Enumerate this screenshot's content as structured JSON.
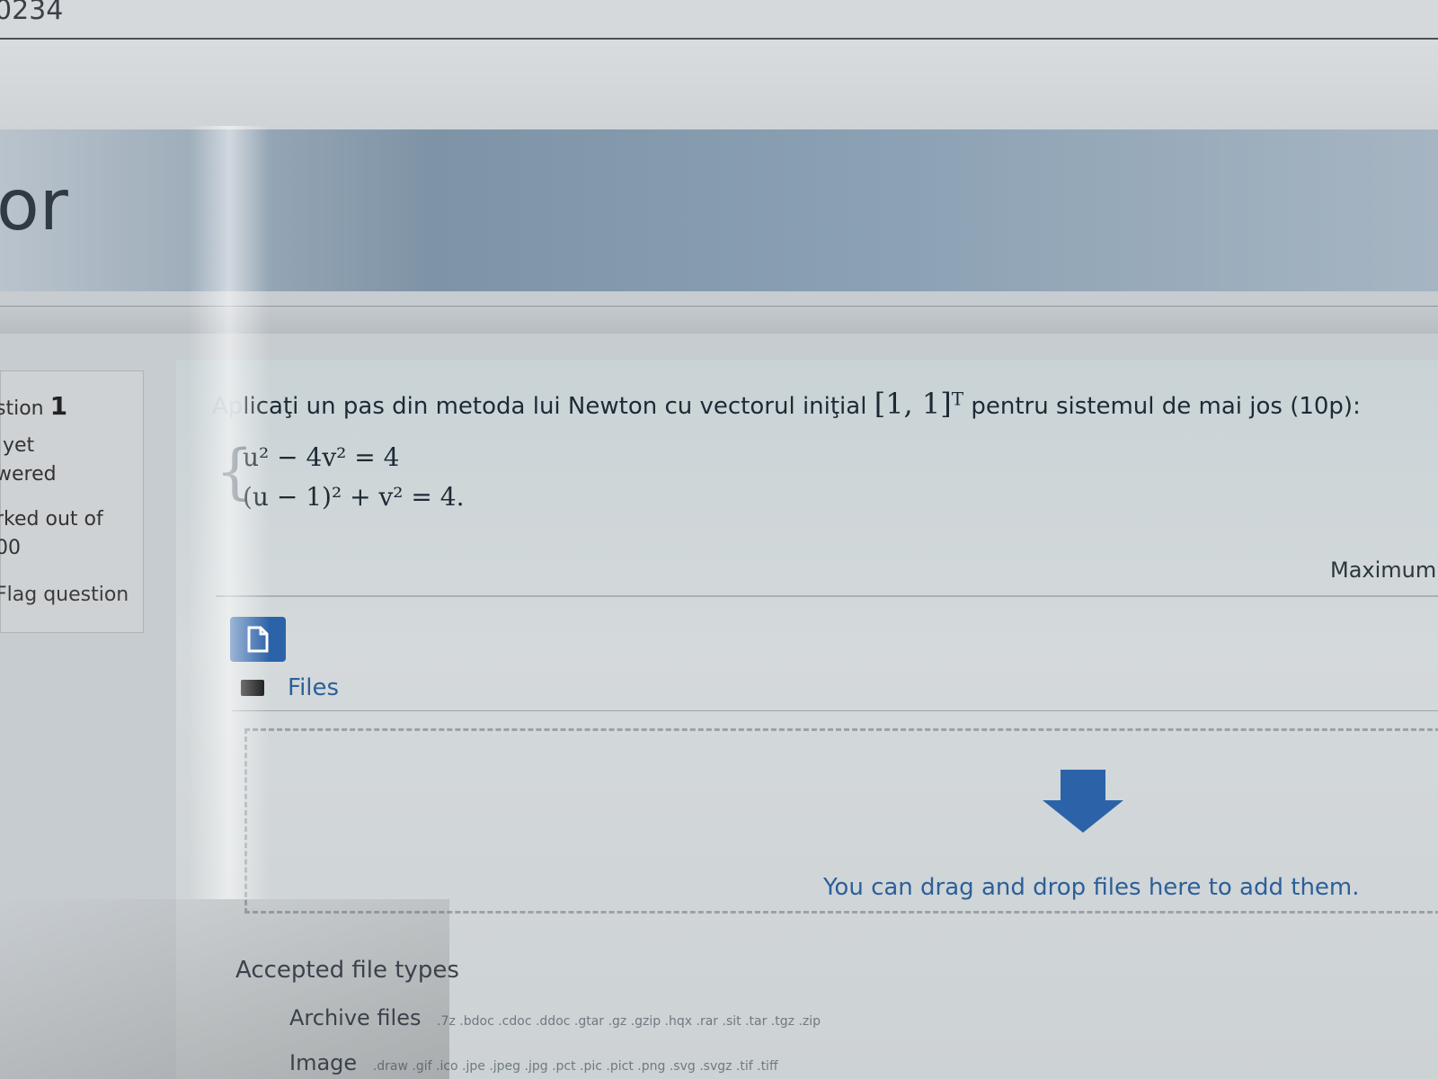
{
  "page": {
    "top_fragment": "0234",
    "header_title_fragment": "or"
  },
  "question_info": {
    "number_prefix": "stion",
    "number": "1",
    "status_line1": "yet",
    "status_line2": "wered",
    "marked_line1": "rked out of",
    "marked_line2": "00",
    "flag_label": "Flag question"
  },
  "question": {
    "text_faded": "Ap",
    "text_before": "licaţi un pas din metoda lui Newton cu vectorul iniţial ",
    "vector": "[1, 1]",
    "vector_sup": "T",
    "text_after": " pentru sistemul de mai jos (10p):",
    "equation1": "u² − 4v² = 4",
    "equation2": "(u − 1)² + v² = 4.",
    "max_label": "Maximum"
  },
  "file_manager": {
    "add_button_icon": "file-icon",
    "folder_icon": "folder-icon",
    "files_label": "Files",
    "drop_text": "You can drag and drop files here to add them.",
    "accepted_label": "Accepted file types",
    "archive_label": "Archive files",
    "archive_extensions": ".7z .bdoc .cdoc .ddoc .gtar .gz .gzip .hqx .rar .sit .tar .tgz .zip",
    "image_label": "Image",
    "image_extensions": ".draw .gif .ico .jpe .jpeg .jpg .pct .pic .pict .png .svg .svgz .tif .tiff"
  },
  "colors": {
    "accent": "#2c63a8",
    "link": "#2c5f99"
  }
}
